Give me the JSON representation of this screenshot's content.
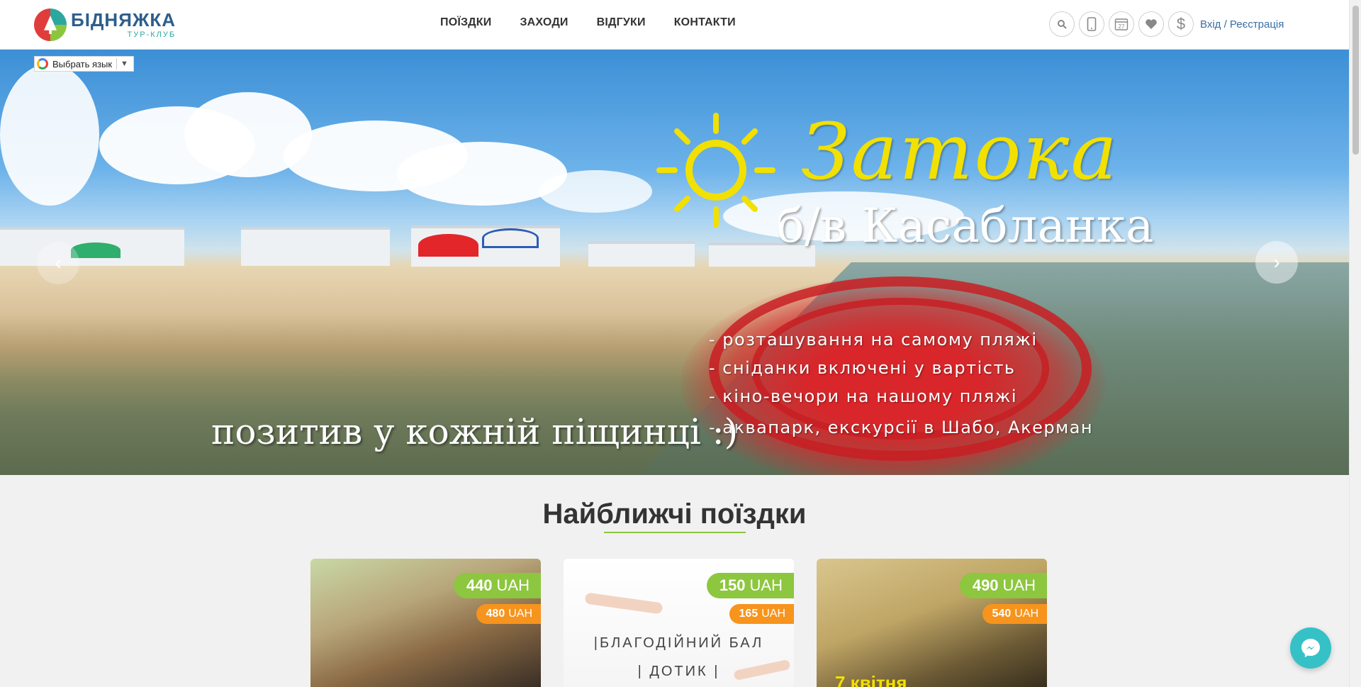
{
  "header": {
    "logo_name": "БІДНЯЖКА",
    "logo_sub": "ТУР-КЛУБ",
    "nav": [
      "ПОЇЗДКИ",
      "ЗАХОДИ",
      "ВІДГУКИ",
      "КОНТАКТИ"
    ],
    "tools": [
      "search-icon",
      "phone-icon",
      "calendar-icon",
      "heart-icon",
      "dollar-icon"
    ],
    "calendar_day": "27",
    "login": "Вхід / Реєстрація"
  },
  "translate": {
    "label": "Выбрать язык"
  },
  "hero": {
    "title": "Затока",
    "subtitle": "б/в Касабланка",
    "bullets": [
      "- розташування на самому пляжі",
      "- сніданки включені у вартість",
      "- кіно-вечори на нашому пляжі",
      "- аквапарк, екскурсії в Шабо, Акерман"
    ],
    "slogan": "позитив у кожній піщинці :)"
  },
  "section": {
    "title": "Найближчі поїздки"
  },
  "cards": [
    {
      "price": "440",
      "currency": "UAH",
      "old_price": "480",
      "old_currency": "UAH"
    },
    {
      "price": "150",
      "currency": "UAH",
      "old_price": "165",
      "old_currency": "UAH",
      "text1": "|БЛАГОДІЙНИЙ БАЛ",
      "text2": "| ДОТИК |"
    },
    {
      "price": "490",
      "currency": "UAH",
      "old_price": "540",
      "old_currency": "UAH",
      "date": "7 квітня"
    }
  ],
  "colors": {
    "accent_green": "#8dc63f",
    "accent_orange": "#f7941d",
    "link_blue": "#3a6ea5",
    "hero_title_yellow": "#f2e000"
  }
}
